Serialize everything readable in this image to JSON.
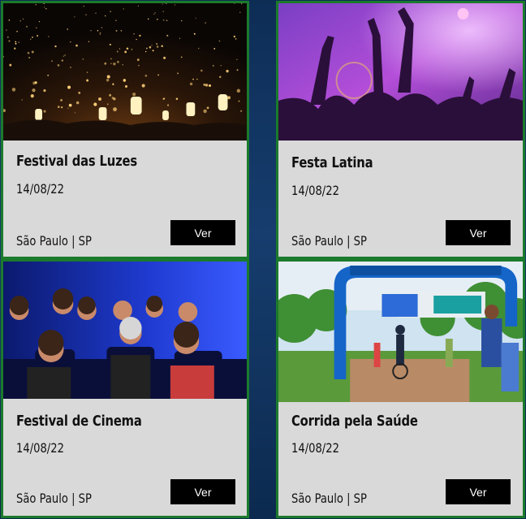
{
  "cards": [
    {
      "title": "Festival das Luzes",
      "date": "14/08/22",
      "location": "São Paulo | SP",
      "button": "Ver",
      "image": "lantern-festival-photo"
    },
    {
      "title": "Festa Latina",
      "date": "14/08/22",
      "location": "São Paulo | SP",
      "button": "Ver",
      "image": "concert-crowd-photo"
    },
    {
      "title": "Festival de Cinema",
      "date": "14/08/22",
      "location": "São Paulo | SP",
      "button": "Ver",
      "image": "cinema-audience-photo"
    },
    {
      "title": "Corrida pela Saúde",
      "date": "14/08/22",
      "location": "São Paulo | SP",
      "button": "Ver",
      "image": "race-finish-line-photo"
    }
  ],
  "colors": {
    "card_bg": "#d9d9d9",
    "card_border": "#1b7a2c",
    "button_bg": "#000000",
    "page_bg": "#163d6e"
  }
}
